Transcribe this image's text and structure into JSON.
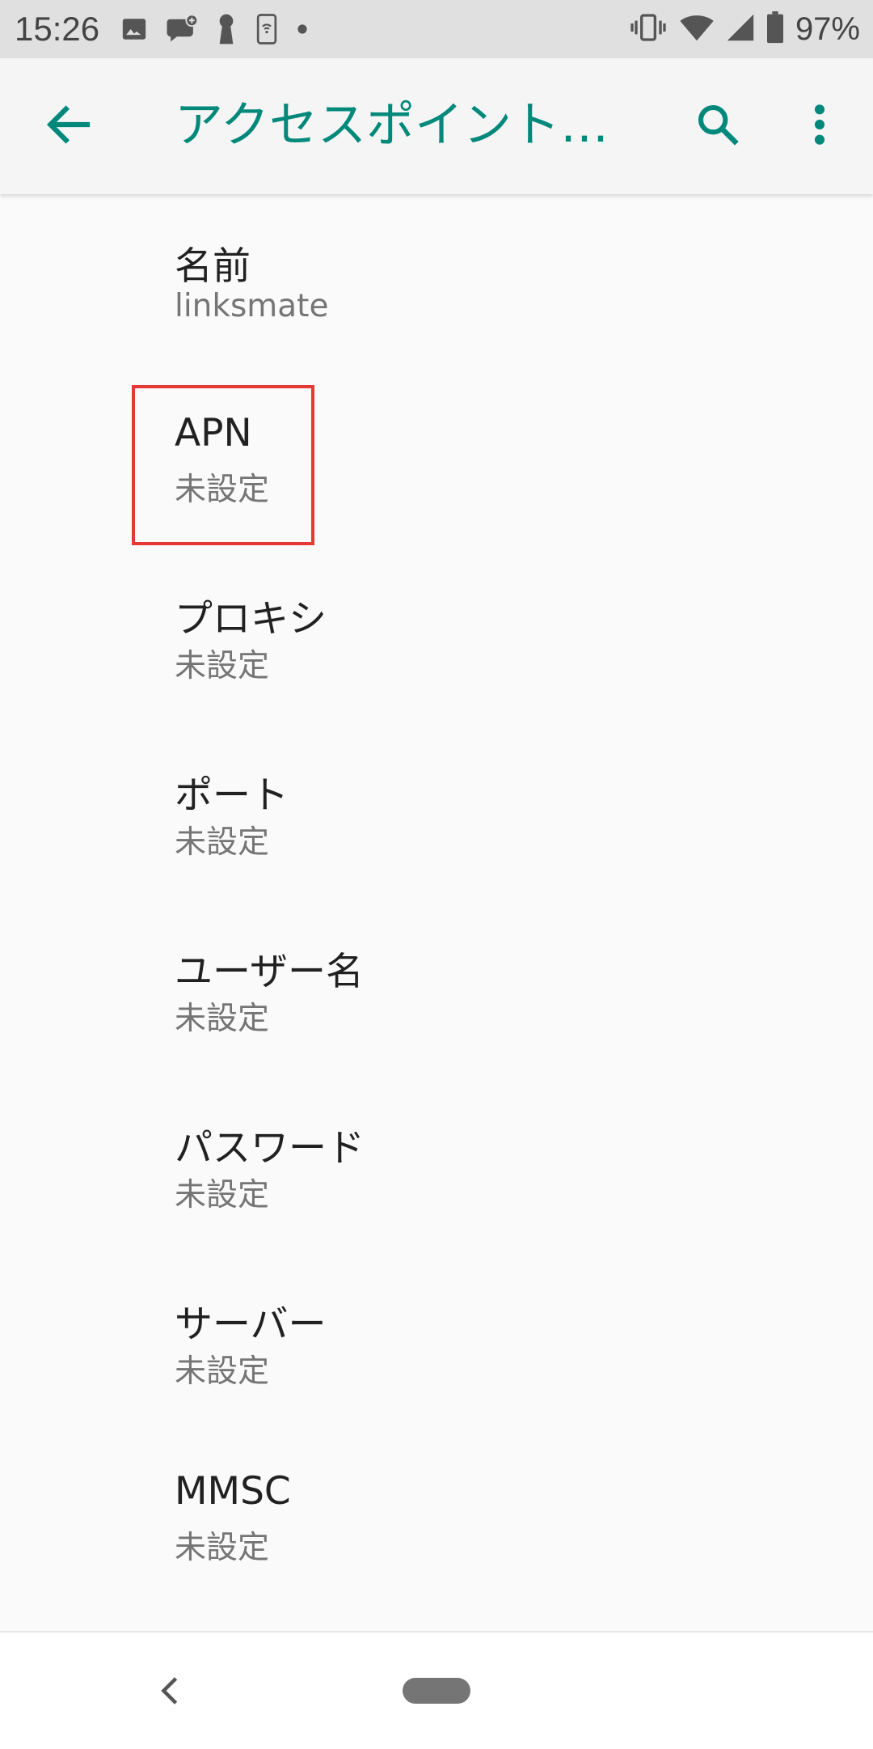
{
  "status_bar": {
    "time": "15:26",
    "battery_text": "97%",
    "left_icons": [
      "image-icon",
      "chat-plus-icon",
      "keyhole-icon",
      "nfc-phone-icon",
      "dot-icon"
    ],
    "right_icons": [
      "vibrate-icon",
      "wifi-icon",
      "signal-icon",
      "battery-icon"
    ]
  },
  "app_bar": {
    "title": "アクセスポイント…",
    "back_icon": "arrow-back-icon",
    "search_icon": "search-icon",
    "menu_icon": "more-vert-icon"
  },
  "settings": {
    "items": [
      {
        "title": "名前",
        "summary": "linksmate"
      },
      {
        "title": "APN",
        "summary": "未設定"
      },
      {
        "title": "プロキシ",
        "summary": "未設定"
      },
      {
        "title": "ポート",
        "summary": "未設定"
      },
      {
        "title": "ユーザー名",
        "summary": "未設定"
      },
      {
        "title": "パスワード",
        "summary": "未設定"
      },
      {
        "title": "サーバー",
        "summary": "未設定"
      },
      {
        "title": "MMSC",
        "summary": "未設定"
      }
    ]
  },
  "colors": {
    "accent": "#00897b",
    "highlight": "#e53935",
    "status_bar_bg": "#e0e0e0",
    "background": "#fafafa"
  },
  "nav_bar": {
    "back_icon": "nav-back-icon",
    "home_icon": "home-pill-icon"
  }
}
